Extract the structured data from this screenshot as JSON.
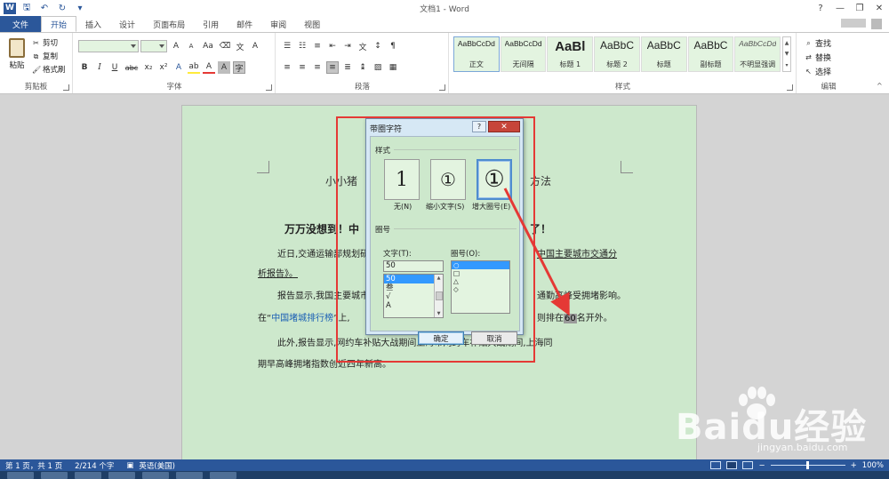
{
  "window": {
    "title": "文档1 - Word",
    "app_icon": "W",
    "controls": [
      "?",
      "—",
      "❐",
      "✕"
    ]
  },
  "qat": {
    "save_icon": "save-icon",
    "undo_icon": "undo-icon",
    "redo_icon": "redo-icon"
  },
  "tabs": [
    "文件",
    "开始",
    "插入",
    "设计",
    "页面布局",
    "引用",
    "邮件",
    "审阅",
    "视图"
  ],
  "ribbon": {
    "clipboard": {
      "label": "剪贴板",
      "paste": "粘贴",
      "cut": "剪切",
      "copy": "复制",
      "format_painter": "格式刷"
    },
    "font": {
      "label": "字体",
      "grow": "A",
      "shrink": "A",
      "case": "Aa",
      "bold": "B",
      "italic": "I",
      "underline": "U",
      "strike": "abc",
      "sub": "x₂",
      "sup": "x²",
      "effects": "A",
      "highlight": "ab",
      "color": "A",
      "shading": "A",
      "enclose": "字"
    },
    "paragraph": {
      "label": "段落"
    },
    "styles": {
      "label": "样式",
      "items": [
        {
          "sample": "AaBbCcDd",
          "name": "正文"
        },
        {
          "sample": "AaBbCcDd",
          "name": "无间隔"
        },
        {
          "sample": "AaBl",
          "name": "标题 1"
        },
        {
          "sample": "AaBbC",
          "name": "标题 2"
        },
        {
          "sample": "AaBbC",
          "name": "标题"
        },
        {
          "sample": "AaBbC",
          "name": "副标题"
        },
        {
          "sample": "AaBbCcDd",
          "name": "不明显强调"
        }
      ]
    },
    "editing": {
      "label": "编辑",
      "find": "查找",
      "replace": "替换",
      "select": "选择"
    }
  },
  "document": {
    "title_line": "小小猪",
    "title_line_end": "方法",
    "headline": "万万没想到！中",
    "headline_end": "了！",
    "para1_a": "近日,交通运输部规划研",
    "para1_b": "中国主要城市交通分",
    "para1_c": "析报告》。",
    "para2_a": "报告显示,我国主要城市",
    "para2_b": "通勤高峰受拥堵影响。",
    "para3_a": "在“",
    "para3_link": "中国堵城排行榜",
    "para3_b": "”上,",
    "para3_c": "则排在",
    "para3_num": "60",
    "para3_d": "名开外。",
    "para4_a": "此外,报告显示,网约车补贴大战期间上海市网约车补贴大战期间,上海同",
    "para5": "期早高峰拥堵指数创近四年新高。"
  },
  "dialog": {
    "title": "带圈字符",
    "help": "?",
    "close": "✕",
    "style_section": "样式",
    "style_options": [
      {
        "glyph": "1",
        "label": "无(N)"
      },
      {
        "glyph": "①",
        "label": "缩小文字(S)"
      },
      {
        "glyph": "①",
        "label": "增大圈号(E)"
      }
    ],
    "circle_section": "圈号",
    "text_label": "文字(T):",
    "text_value": "50",
    "text_options": [
      "50",
      "叁",
      "√",
      "A"
    ],
    "circle_label": "圈号(O):",
    "circle_options": [
      "○",
      "□",
      "△",
      "◇"
    ],
    "ok": "确定",
    "cancel": "取消"
  },
  "status": {
    "page": "第 1 页，共 1 页",
    "words": "2/214 个字",
    "language": "英语(美国)",
    "zoom": "100%"
  },
  "watermark": {
    "brand": "Baidu经验",
    "url": "jingyan.baidu.com"
  }
}
